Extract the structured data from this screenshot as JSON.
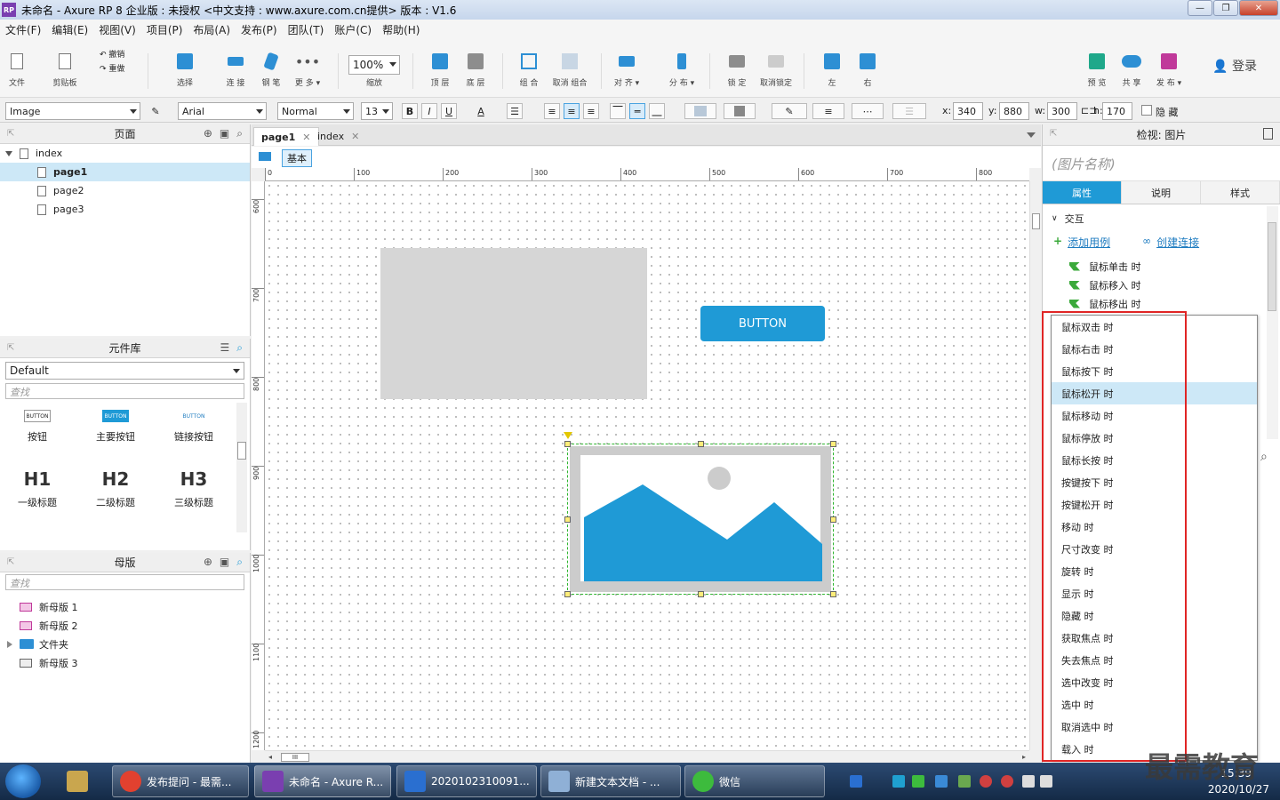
{
  "window": {
    "title": "未命名 - Axure RP 8 企业版 : 未授权      <中文支持 : www.axure.com.cn提供> 版本 : V1.6",
    "app_icon": "RP"
  },
  "menu": [
    "文件(F)",
    "编辑(E)",
    "视图(V)",
    "项目(P)",
    "布局(A)",
    "发布(P)",
    "团队(T)",
    "账户(C)",
    "帮助(H)"
  ],
  "toolbar": {
    "file": "文件",
    "clipboard": "剪贴板",
    "undo": "撤销",
    "redo": "重做",
    "select": "选择",
    "connect": "连 接",
    "pen": "钢 笔",
    "more": "更 多 ▾",
    "zoom_value": "100%",
    "zoom_label": "缩放",
    "top": "顶 层",
    "bottom": "底 层",
    "group": "组 合",
    "ungroup": "取消 组合",
    "align": "对 齐 ▾",
    "distribute": "分 布 ▾",
    "lock": "锁 定",
    "unlock": "取消锁定",
    "left": "左",
    "right": "右",
    "preview": "预 览",
    "share": "共 享",
    "publish": "发 布 ▾",
    "login": "登录"
  },
  "formatbar": {
    "widget_type": "Image",
    "font": "Arial",
    "style": "Normal",
    "size": "13",
    "bold": "B",
    "italic": "I",
    "underline": "U",
    "font_color": "A",
    "x_label": "x:",
    "x": "340",
    "y_label": "y:",
    "y": "880",
    "w_label": "w:",
    "w": "300",
    "h_label": "h:",
    "h": "170",
    "hide_label": "隐 藏"
  },
  "pages_panel": {
    "title": "页面",
    "root": "index",
    "pages": [
      "page1",
      "page2",
      "page3"
    ],
    "selected": "page1"
  },
  "library_panel": {
    "title": "元件库",
    "library": "Default",
    "search_placeholder": "查找",
    "widgets": [
      {
        "thumb": "BUTTON",
        "label": "按钮"
      },
      {
        "thumb": "BUTTON",
        "label": "主要按钮"
      },
      {
        "thumb": "BUTTON",
        "label": "链接按钮"
      },
      {
        "thumb": "H1",
        "label": "一级标题"
      },
      {
        "thumb": "H2",
        "label": "二级标题"
      },
      {
        "thumb": "H3",
        "label": "三级标题"
      }
    ]
  },
  "masters_panel": {
    "title": "母版",
    "search_placeholder": "查找",
    "items": [
      "新母版 1",
      "新母版 2",
      "文件夹",
      "新母版 3"
    ]
  },
  "canvas": {
    "tabs": [
      {
        "label": "page1",
        "active": true
      },
      {
        "label": "index",
        "active": false
      }
    ],
    "adaptive_view": "基本",
    "ruler_top": [
      "0",
      "100",
      "200",
      "300",
      "400",
      "500",
      "600",
      "700",
      "800"
    ],
    "ruler_left": [
      "600",
      "700",
      "800",
      "900",
      "1000",
      "1100",
      "1200"
    ],
    "button_label": "BUTTON",
    "hscroll_thumb": "III"
  },
  "inspector": {
    "title": "检视: 图片",
    "name_placeholder": "(图片名称)",
    "tabs": [
      "属性",
      "说明",
      "样式"
    ],
    "section": "交互",
    "add_case": "添加用例",
    "create_link": "创建连接",
    "events": [
      "鼠标单击 时",
      "鼠标移入 时",
      "鼠标移出 时"
    ]
  },
  "event_menu": {
    "hovered": "鼠标松开 时",
    "items": [
      "鼠标双击 时",
      "鼠标右击 时",
      "鼠标按下 时",
      "鼠标松开 时",
      "鼠标移动 时",
      "鼠标停放 时",
      "鼠标长按 时",
      "按键按下 时",
      "按键松开 时",
      "移动 时",
      "尺寸改变 时",
      "旋转 时",
      "显示 时",
      "隐藏 时",
      "获取焦点 时",
      "失去焦点 时",
      "选中改变 时",
      "选中 时",
      "取消选中 时",
      "载入 时"
    ]
  },
  "watermark": "最需教育",
  "taskbar": {
    "items": [
      {
        "label": "",
        "color": "#c9a64e"
      },
      {
        "label": "发布提问 - 最需...",
        "color": "#e2412f"
      },
      {
        "label": "未命名 - Axure R...",
        "color": "#7a3fb0"
      },
      {
        "label": "2020102310091...",
        "color": "#2a6fd0"
      },
      {
        "label": "新建文本文档 - ...",
        "color": "#8fb0d6"
      },
      {
        "label": "微信",
        "color": "#3dbb3d"
      }
    ],
    "time": "15:39",
    "date": "2020/10/27"
  },
  "colors": {
    "accent": "#1f9ad6",
    "selection_outline": "#e02525",
    "hover_row": "#cde8f7",
    "taskbar": "#1c3556"
  }
}
